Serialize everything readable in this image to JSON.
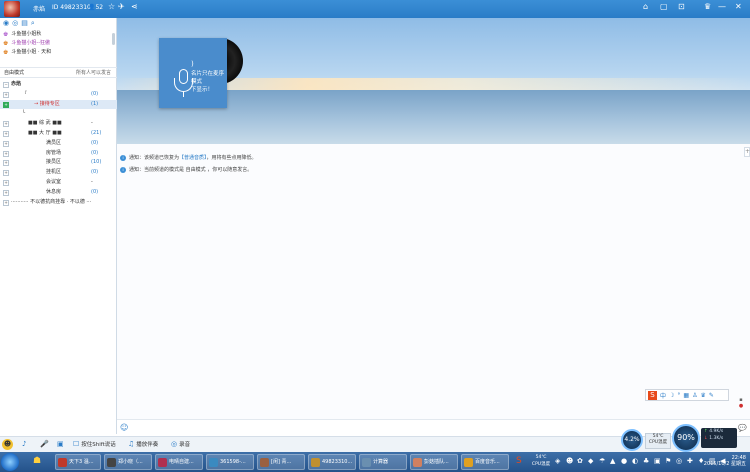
{
  "titlebar": {
    "name": "赤焰",
    "id": "ID 49823310",
    "count": "52"
  },
  "sidebar": {
    "channels": [
      {
        "label": "斗鱼猫小姐秋",
        "color": "#b060d0"
      },
      {
        "label": "斗鱼猫小姐--狂傲",
        "color": "#d05ad0"
      },
      {
        "label": "斗鱼猫小姐 · 天和",
        "color": "#c08020"
      }
    ],
    "mode_label": "自由模式",
    "mode_right": "所有人可以发言",
    "tree": [
      {
        "label": "赤焰",
        "count": "",
        "bold": true
      },
      {
        "label": "『",
        "count": "(0)"
      },
      {
        "label": "→  接待专区",
        "count": "(1)",
        "selected": true
      },
      {
        "label": "└",
        "count": ""
      },
      {
        "label": "■■  综 武  ■■",
        "count": "-"
      },
      {
        "label": "■■  大 厅  ■■",
        "count": "(21)"
      },
      {
        "label": "满员区",
        "count": "(0)"
      },
      {
        "label": "房管场",
        "count": "(0)"
      },
      {
        "label": "接员区",
        "count": "(10)"
      },
      {
        "label": "挂机区",
        "count": "(0)"
      },
      {
        "label": "会议室",
        "count": "-"
      },
      {
        "label": "休息房",
        "count": "(0)"
      },
      {
        "label": "··········· 不以德抗商挂靠 · 不以德 ···",
        "count": ""
      }
    ]
  },
  "banner": {
    "cover_text_line1": "名片只在麦序模式",
    "cover_text_line2": "下显示！"
  },
  "chat": {
    "notices": [
      {
        "prefix": "通知：",
        "text_before": "该频道已恢复为",
        "highlight": "【普通音质】",
        "text_after": "，用将有些点用降低。"
      },
      {
        "prefix": "通知：",
        "text_before": "当前频道的模式是 自由模式 ，你可以随意发言。",
        "highlight": "",
        "text_after": ""
      }
    ]
  },
  "bottombar": {
    "items": [
      {
        "icon": "speaker-icon",
        "label": ""
      },
      {
        "icon": "mic-icon",
        "label": ""
      },
      {
        "icon": "screen-icon",
        "label": "按住Shift说话"
      },
      {
        "icon": "music-icon",
        "label": "播放伴奏"
      },
      {
        "icon": "record-icon",
        "label": "录音"
      }
    ]
  },
  "widget": {
    "cpu_pct": "4.2%",
    "cpu_temp": "54℃",
    "cpu_label": "CPU温度",
    "mem_pct": "90%",
    "up": "4.9K/s",
    "down": "1.3K/s"
  },
  "taskbar": {
    "tasks": [
      {
        "label": "天下3 温...",
        "color": "#c0392b"
      },
      {
        "label": "郑小晓（...",
        "color": "#444"
      },
      {
        "label": "电晴自建...",
        "color": "#b03050"
      },
      {
        "label": "361598-...",
        "color": "#3a8ac0"
      },
      {
        "label": "[闲] 青...",
        "color": "#9a6040"
      },
      {
        "label": "49823310...",
        "color": "#c09030"
      },
      {
        "label": "计算器",
        "color": "#6a8fb0"
      },
      {
        "label": "彭菇插队...",
        "color": "#d08060"
      },
      {
        "label": "百度音乐...",
        "color": "#e0a020"
      }
    ],
    "tray_temp": "54℃",
    "tray_temp_label": "CPU温度",
    "time": "22:48",
    "date": "2015/10/2 星期五"
  }
}
